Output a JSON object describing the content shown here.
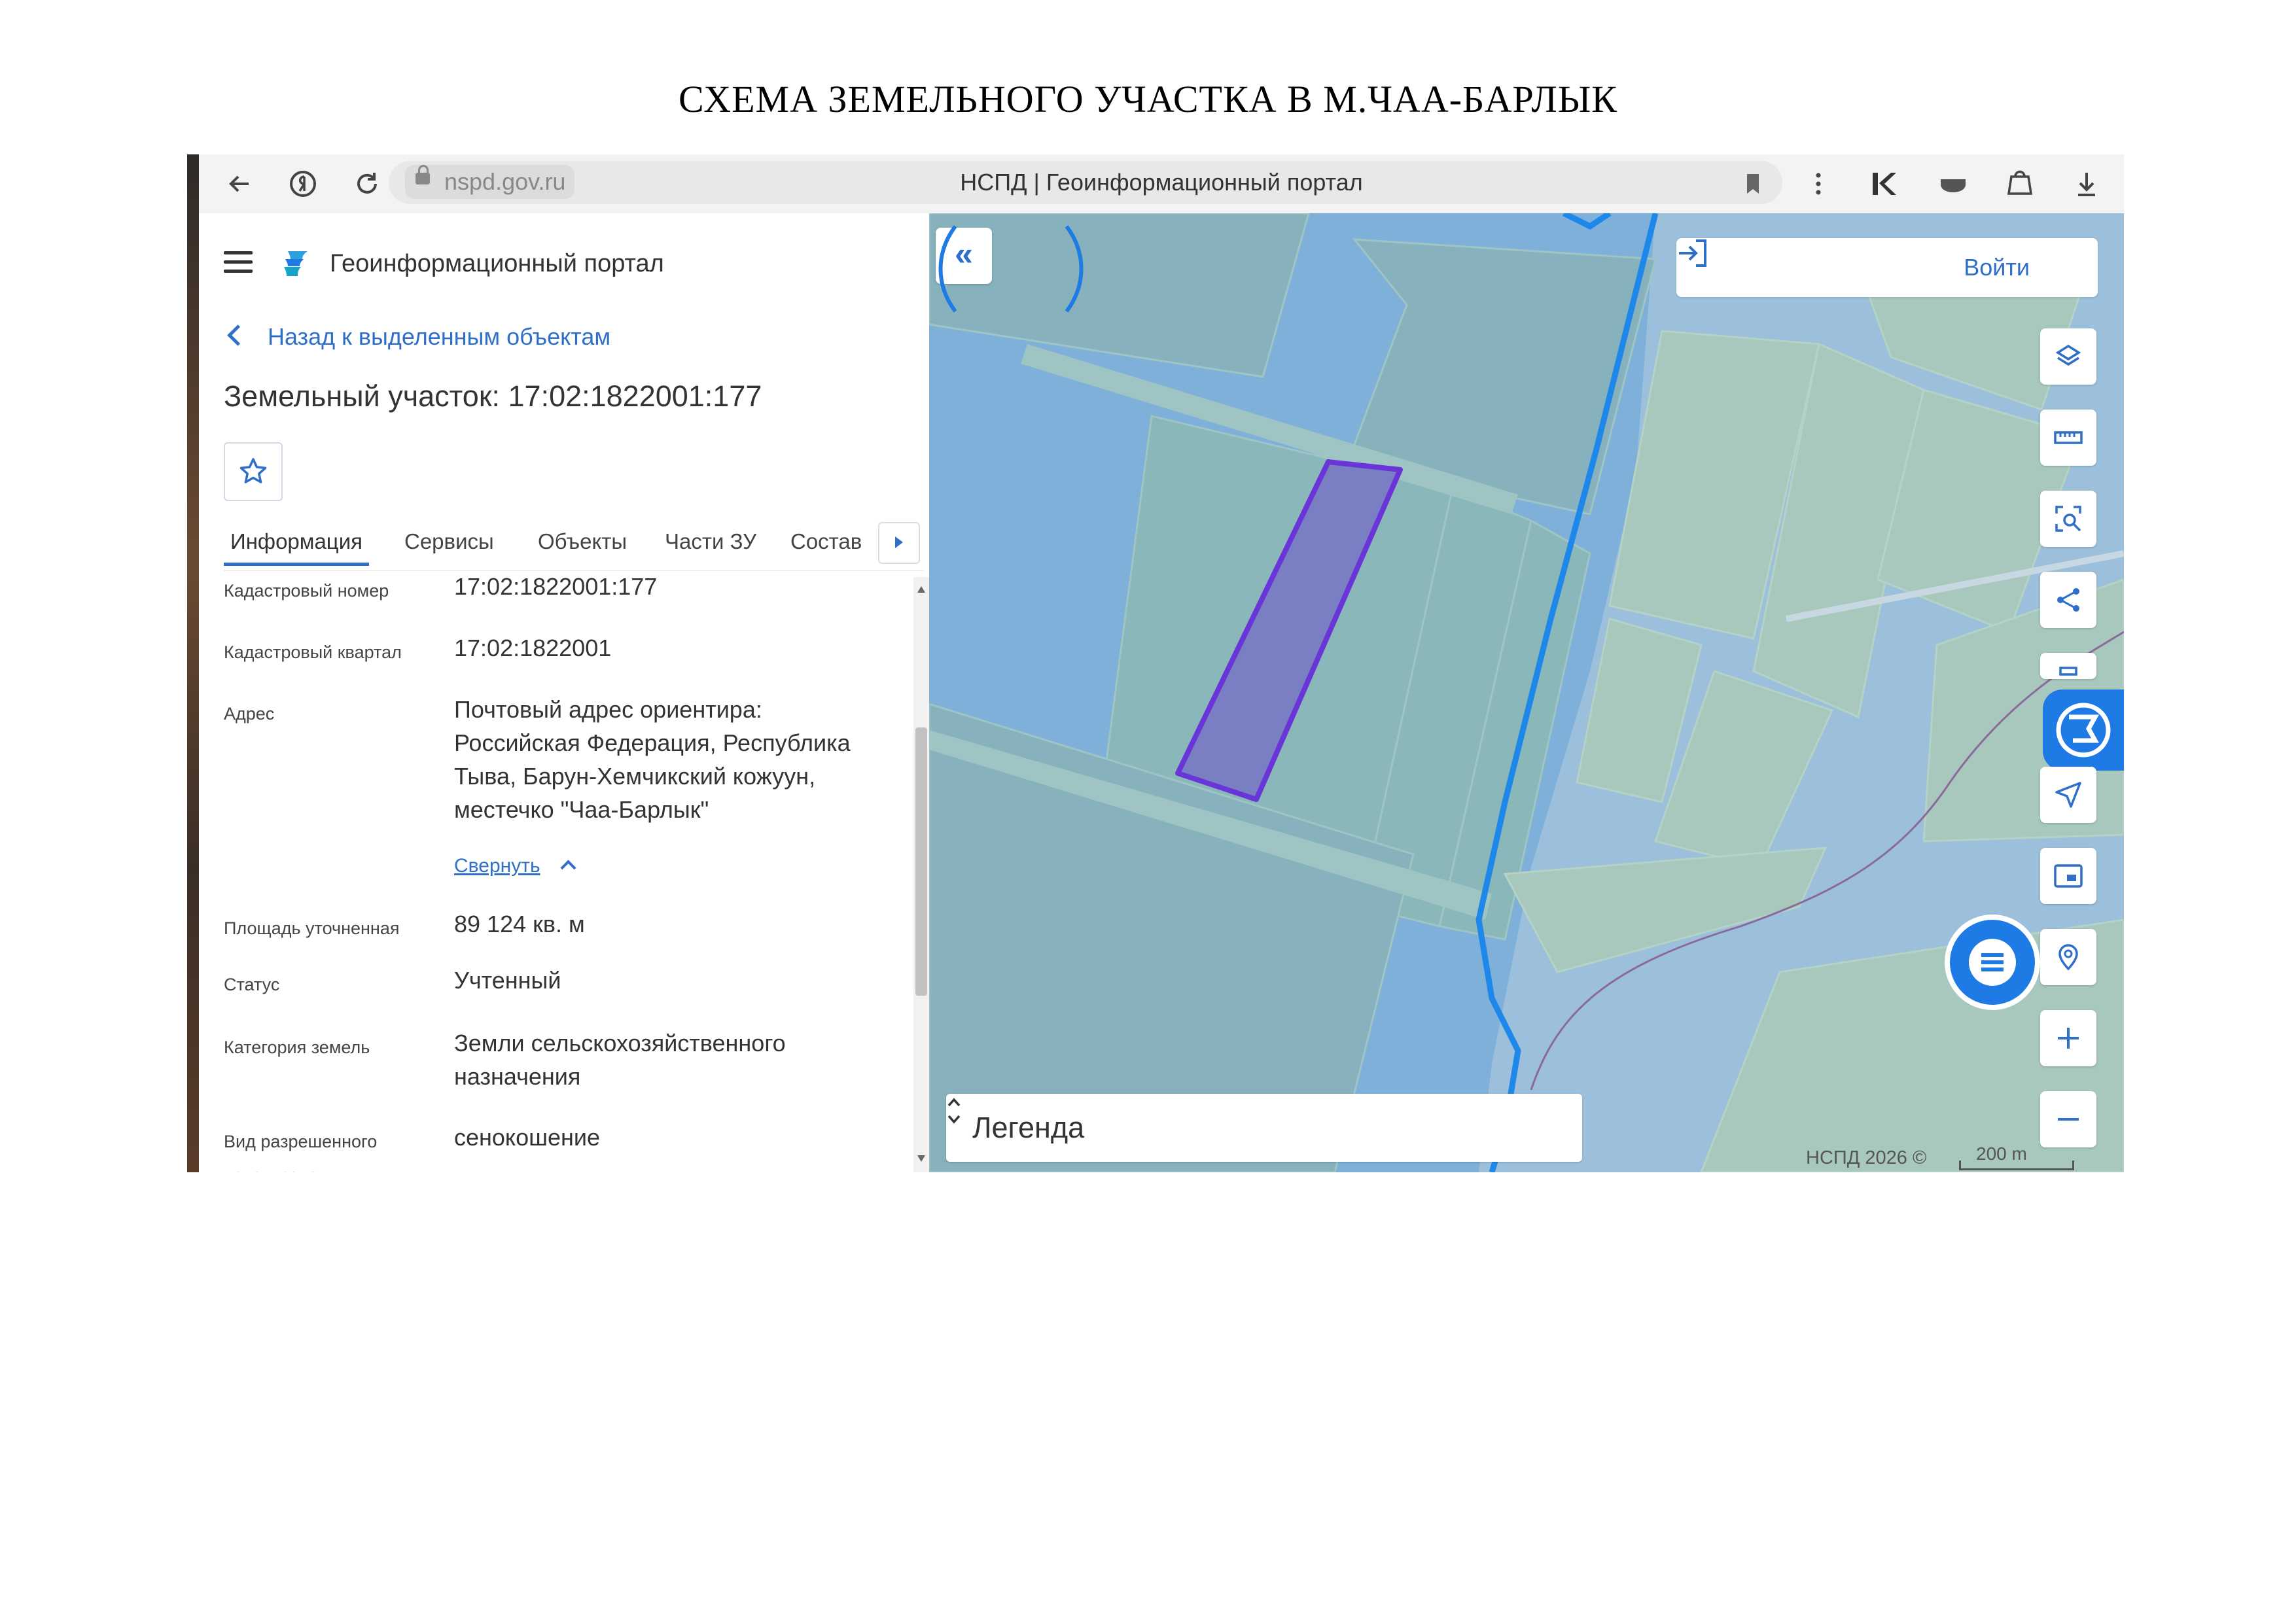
{
  "document": {
    "title": "СХЕМА ЗЕМЕЛЬНОГО УЧАСТКА В М.ЧАА-БАРЛЫК"
  },
  "browser": {
    "url_host": "nspd.gov.ru",
    "page_title": "НСПД | Геоинформационный портал",
    "icons": [
      "back-arrow-icon",
      "yandex-icon",
      "reload-icon",
      "lock-icon",
      "bookmark-icon",
      "kebab-menu-icon",
      "extension-icon",
      "shield-icon",
      "bag-icon",
      "download-icon"
    ]
  },
  "panel": {
    "portal_name": "Геоинформационный портал",
    "back_link": "Назад к выделенным объектам",
    "object_title": "Земельный участок: 17:02:1822001:177",
    "tabs": [
      {
        "label": "Информация",
        "active": true
      },
      {
        "label": "Сервисы",
        "active": false
      },
      {
        "label": "Объекты",
        "active": false
      },
      {
        "label": "Части ЗУ",
        "active": false
      },
      {
        "label": "Состав",
        "active": false
      }
    ],
    "rows": {
      "cadastral_number": {
        "label": "Кадастровый номер",
        "value": "17:02:1822001:177"
      },
      "cadastral_quarter": {
        "label": "Кадастровый квартал",
        "value": "17:02:1822001"
      },
      "address": {
        "label": "Адрес",
        "lines": [
          "Почтовый адрес ориентира:",
          "Российская Федерация, Республика",
          "Тыва, Барун-Хемчикский кожуун,",
          "местечко \"Чаа-Барлык\""
        ]
      },
      "collapse_link": "Свернуть",
      "area": {
        "label": "Площадь уточненная",
        "value": "89 124 кв. м"
      },
      "status": {
        "label": "Статус",
        "value": "Учтенный"
      },
      "land_category": {
        "label": "Категория земель",
        "lines": [
          "Земли сельскохозяйственного",
          "назначения"
        ]
      },
      "permitted_use": {
        "label_lines": [
          "Вид разрешенного",
          "использования"
        ],
        "value": "сенокошение"
      }
    }
  },
  "map": {
    "login_label": "Войти",
    "legend_label": "Легенда",
    "copyright": "НСПД 2026 ©",
    "scale_label": "200 m",
    "colors": {
      "water": "#7fb0d9",
      "parcel": "#8fb8b8",
      "selected_fill": "#7a7fc4",
      "selected_stroke": "#6a35d8",
      "boundary": "#1e88ea",
      "accent": "#2f6fc9"
    },
    "tools": [
      "layers-icon",
      "ruler-icon",
      "area-search-icon",
      "share-icon",
      "print-icon",
      "navigate-icon",
      "minimap-icon",
      "location-search-icon",
      "zoom-in-icon",
      "zoom-out-icon"
    ]
  }
}
